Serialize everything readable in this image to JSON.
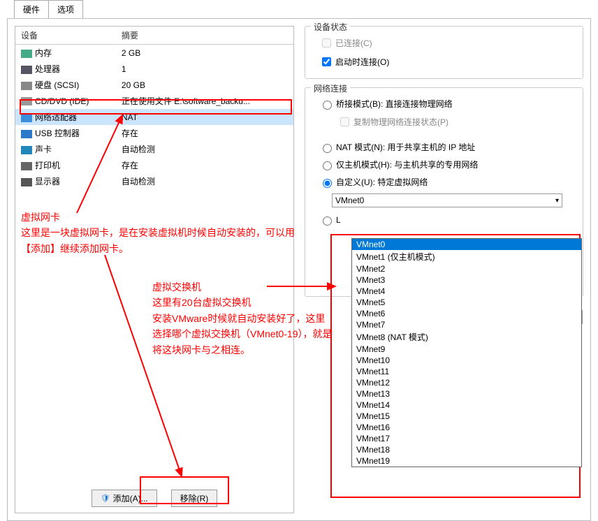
{
  "tabs": {
    "hardware": "硬件",
    "options": "选项"
  },
  "headers": {
    "device": "设备",
    "summary": "摘要"
  },
  "devices": [
    {
      "name": "内存",
      "summary": "2 GB",
      "icon": "#4a8"
    },
    {
      "name": "处理器",
      "summary": "1",
      "icon": "#556"
    },
    {
      "name": "硬盘 (SCSI)",
      "summary": "20 GB",
      "icon": "#888"
    },
    {
      "name": "CD/DVD (IDE)",
      "summary": "正在使用文件 E:\\software_backu...",
      "icon": "#999"
    },
    {
      "name": "网络适配器",
      "summary": "NAT",
      "icon": "#3a8edb",
      "selected": true
    },
    {
      "name": "USB 控制器",
      "summary": "存在",
      "icon": "#2a7ac9"
    },
    {
      "name": "声卡",
      "summary": "自动检测",
      "icon": "#28b"
    },
    {
      "name": "打印机",
      "summary": "存在",
      "icon": "#666"
    },
    {
      "name": "显示器",
      "summary": "自动检测",
      "icon": "#555"
    }
  ],
  "status": {
    "legend": "设备状态",
    "connected": "已连接(C)",
    "poweron": "启动时连接(O)"
  },
  "netconn": {
    "legend": "网络连接",
    "bridged": "桥接模式(B): 直接连接物理网络",
    "replicate": "复制物理网络连接状态(P)",
    "nat": "NAT 模式(N): 用于共享主机的 IP 地址",
    "hostonly": "仅主机模式(H): 与主机共享的专用网络",
    "custom": "自定义(U): 特定虚拟网络",
    "lan": "L",
    "selected": "VMnet0",
    "lanbtn": ")..."
  },
  "vmnets": [
    "VMnet0",
    "VMnet1 (仅主机模式)",
    "VMnet2",
    "VMnet3",
    "VMnet4",
    "VMnet5",
    "VMnet6",
    "VMnet7",
    "VMnet8 (NAT 模式)",
    "VMnet9",
    "VMnet10",
    "VMnet11",
    "VMnet12",
    "VMnet13",
    "VMnet14",
    "VMnet15",
    "VMnet16",
    "VMnet17",
    "VMnet18",
    "VMnet19"
  ],
  "buttons": {
    "add": "添加(A)...",
    "remove": "移除(R)"
  },
  "annotations": {
    "nic": "虚拟网卡\n这里是一块虚拟网卡，是在安装虚拟机时候自动安装的，可以用【添加】继续添加网卡。",
    "switch": "虚拟交换机\n这里有20台虚拟交换机\n安装VMware时候就自动安装好了，这里选择哪个虚拟交换机（VMnet0-19），就是将这块网卡与之相连。"
  }
}
